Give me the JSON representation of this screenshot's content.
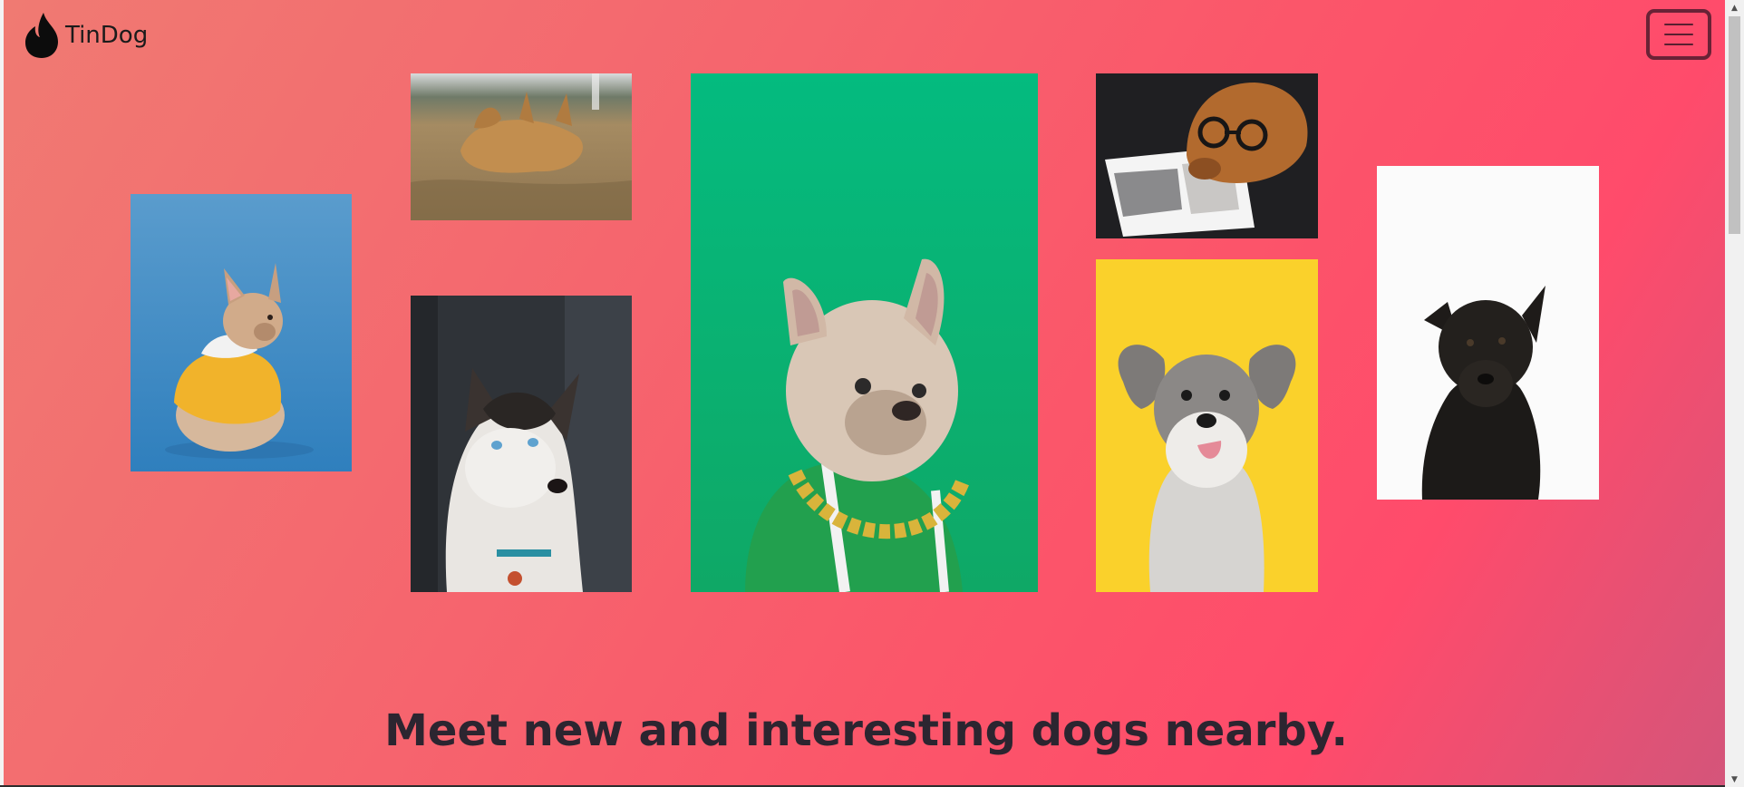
{
  "navbar": {
    "brand_name": "TinDog",
    "brand_icon": "flame-icon",
    "toggler_icon": "hamburger-menu-icon"
  },
  "gallery": {
    "photos": [
      {
        "subject": "french-bulldog-yellow-hoodie"
      },
      {
        "subject": "golden-dog-rolling-in-grass"
      },
      {
        "subject": "husky-portrait"
      },
      {
        "subject": "french-bulldog-green-jacket-gold-chain"
      },
      {
        "subject": "retriever-with-glasses-reading"
      },
      {
        "subject": "schnauzer-yellow-background"
      },
      {
        "subject": "black-dog-white-background"
      }
    ]
  },
  "hero": {
    "tagline": "Meet new and interesting dogs nearby."
  },
  "colors": {
    "gradient_start": "#f07a72",
    "gradient_mid": "#ff4b6b",
    "text_dark": "#2c2530",
    "toggler_border": "#6a2236"
  },
  "scrollbar": {
    "up_arrow": "▲",
    "down_arrow": "▼"
  }
}
